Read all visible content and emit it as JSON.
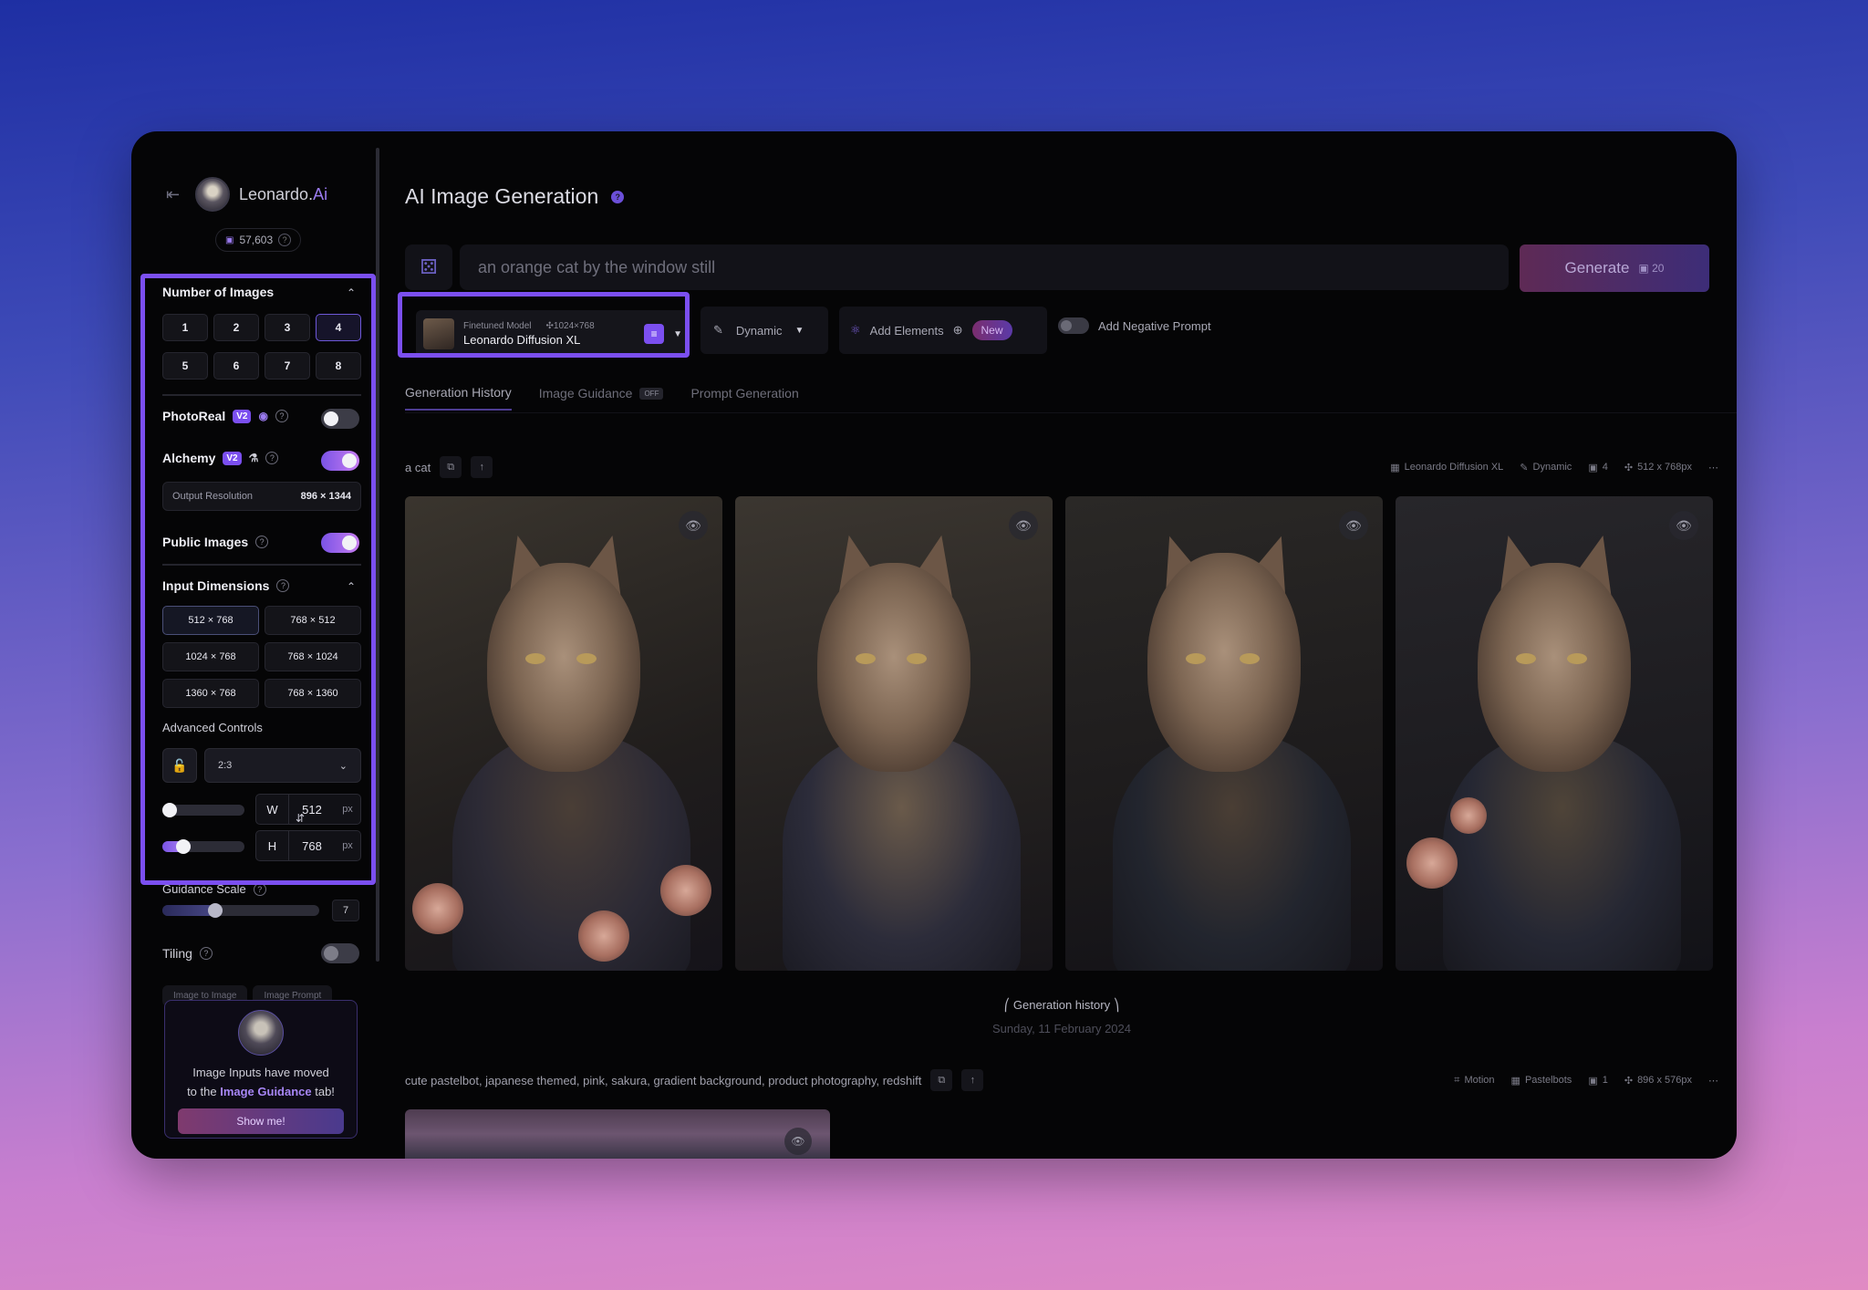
{
  "brand": {
    "name_main": "Leonardo.",
    "name_accent": "Ai",
    "back_icon": "back-arrow-icon"
  },
  "tokens": {
    "count": "57,603"
  },
  "sidebar": {
    "number_of_images": {
      "title": "Number of Images",
      "options": [
        "1",
        "2",
        "3",
        "4",
        "5",
        "6",
        "7",
        "8"
      ],
      "selected": "4"
    },
    "photoreal": {
      "label": "PhotoReal",
      "badge": "V2",
      "enabled": false
    },
    "alchemy": {
      "label": "Alchemy",
      "badge": "V2",
      "enabled": true
    },
    "output_resolution": {
      "label": "Output Resolution",
      "value": "896 × 1344"
    },
    "public_images": {
      "label": "Public Images",
      "enabled": true
    },
    "input_dimensions": {
      "title": "Input Dimensions",
      "options": [
        "512 × 768",
        "768 × 512",
        "1024 × 768",
        "768 × 1024",
        "1360 × 768",
        "768 × 1360"
      ],
      "selected": "512 × 768"
    },
    "advanced_controls": {
      "label": "Advanced Controls",
      "aspect_ratio": "2:3"
    },
    "width": {
      "label": "W",
      "value": "512",
      "unit": "px",
      "slider_fraction": 0.0
    },
    "height": {
      "label": "H",
      "value": "768",
      "unit": "px",
      "slider_fraction": 0.2
    },
    "guidance_scale": {
      "label": "Guidance Scale",
      "value": "7",
      "slider_fraction": 0.32
    },
    "tiling": {
      "label": "Tiling",
      "enabled": false
    },
    "image_tabs": [
      "Image to Image",
      "Image Prompt"
    ],
    "moved_card": {
      "line1": "Image Inputs have moved",
      "line2_pre": "to the ",
      "line2_link": "Image Guidance",
      "line2_post": " tab!",
      "button": "Show me!"
    }
  },
  "main": {
    "title": "AI Image Generation",
    "prompt_placeholder": "an orange cat by the window still",
    "generate": {
      "label": "Generate",
      "cost": "20"
    },
    "model": {
      "sub_label": "Finetuned Model",
      "dims": "1024×768",
      "name": "Leonardo Diffusion XL"
    },
    "style": {
      "label": "Dynamic"
    },
    "elements": {
      "label": "Add Elements",
      "badge": "New"
    },
    "negative_prompt": {
      "label": "Add Negative Prompt",
      "enabled": false
    },
    "tabs": [
      {
        "label": "Generation History",
        "active": true
      },
      {
        "label": "Image Guidance",
        "badge": "OFF"
      },
      {
        "label": "Prompt Generation"
      }
    ],
    "generations": [
      {
        "prompt": "a cat",
        "meta": {
          "model": "Leonardo Diffusion XL",
          "style": "Dynamic",
          "count": "4",
          "size": "512 x 768px"
        }
      },
      {
        "prompt": "cute pastelbot, japanese themed, pink, sakura, gradient background, product photography, redshift",
        "meta": {
          "model": "Motion",
          "style": "Pastelbots",
          "count": "1",
          "size": "896 x 576px"
        }
      }
    ],
    "history_divider": "Generation history",
    "history_date": "Sunday, 11 February 2024"
  },
  "colors": {
    "accent": "#7b4ff0",
    "highlight": "#7b4ff0"
  }
}
